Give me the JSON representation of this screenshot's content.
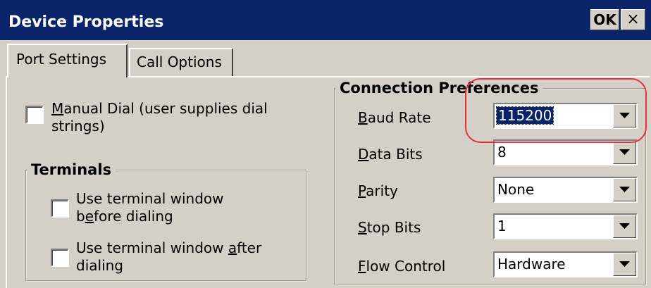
{
  "window": {
    "title": "Device Properties",
    "ok_label": "OK",
    "close_label": "×"
  },
  "tabs": [
    {
      "label": "Port Settings",
      "active": true
    },
    {
      "label": "Call Options",
      "active": false
    }
  ],
  "manual_dial": {
    "label_line1_rest": "anual Dial (user supplies dial",
    "label_line1_mnemonic": "M",
    "label_line2": "strings)",
    "checked": false
  },
  "terminals": {
    "title": "Terminals",
    "before": {
      "line1": "Use terminal window",
      "line2_pre": "b",
      "line2_mnemonic": "e",
      "line2_post": "fore dialing",
      "checked": false
    },
    "after": {
      "line1_pre": "Use terminal window ",
      "line1_mnemonic": "a",
      "line1_post": "fter",
      "line2": "dialing",
      "checked": false
    }
  },
  "connection": {
    "title": "Connection Preferences",
    "fields": [
      {
        "mnemonic": "B",
        "rest": "aud Rate",
        "value": "115200",
        "focused": true
      },
      {
        "mnemonic": "D",
        "rest": "ata Bits",
        "value": "8",
        "focused": false
      },
      {
        "mnemonic": "P",
        "rest": "arity",
        "value": "None",
        "focused": false
      },
      {
        "mnemonic": "S",
        "rest": "top Bits",
        "value": "1",
        "focused": false
      },
      {
        "mnemonic": "F",
        "rest": "low Control",
        "value": "Hardware",
        "focused": false
      }
    ]
  },
  "colors": {
    "titlebar": "#0a246a",
    "face": "#d4d0c8",
    "highlight_ring": "#e8303b"
  }
}
